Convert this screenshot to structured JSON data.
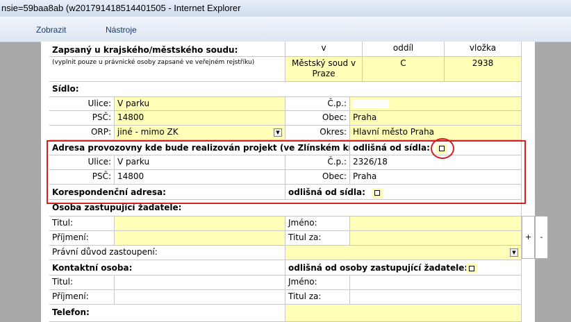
{
  "window": {
    "title": "nsie=59baa8ab (w201791418514401505 - Internet Explorer"
  },
  "menu": [
    "Zobrazit",
    "Nástroje"
  ],
  "court": {
    "label": "Zapsaný u krajského/městského soudu:",
    "note": "(vyplnit pouze u právnické osoby zapsané ve veřejném rejstříku)",
    "headers": [
      "v",
      "oddíl",
      "vložka"
    ],
    "v_value_line1": "Městský soud v",
    "v_value_line2": "Praze",
    "oddil_value": "C",
    "vlozka_value": "2938"
  },
  "sidlo": {
    "heading": "Sídlo:",
    "ulice_label": "Ulice:",
    "ulice_value": "V parku",
    "cp_label": "Č.p.:",
    "psc_label": "PSČ:",
    "psc_value": "14800",
    "obec_label": "Obec:",
    "obec_value": "Praha",
    "orp_label": "ORP:",
    "orp_value": "jiné - mimo ZK",
    "okres_label": "Okres:",
    "okres_value": "Hlavní město Praha"
  },
  "provozovna": {
    "heading": "Adresa provozovny kde bude realizován projekt (ve Zlínském kraji):",
    "odlisna_label": "odlišná od sídla:",
    "ulice_label": "Ulice:",
    "ulice_value": "V parku",
    "cp_label": "Č.p.:",
    "cp_value": "2326/18",
    "psc_label": "PSČ:",
    "psc_value": "14800",
    "obec_label": "Obec:",
    "obec_value": "Praha"
  },
  "korespondencni": {
    "heading": "Korespondenční adresa:",
    "odlisna_label": "odlišná od sídla:"
  },
  "zastupce": {
    "heading": "Osoba zastupující žadatele:",
    "titul_label": "Titul:",
    "jmeno_label": "Jméno:",
    "prijmeni_label": "Příjmení:",
    "titul_za_label": "Titul za:",
    "duvod_label": "Právní důvod zastoupení:",
    "plus": "+",
    "minus": "-"
  },
  "kontakt": {
    "heading": "Kontaktní osoba:",
    "odlisna_label": "odlišná od osoby zastupující žadatele:",
    "titul_label": "Titul:",
    "jmeno_label": "Jméno:",
    "prijmeni_label": "Příjmení:",
    "titul_za_label": "Titul za:"
  },
  "telefon": {
    "label": "Telefon:"
  }
}
